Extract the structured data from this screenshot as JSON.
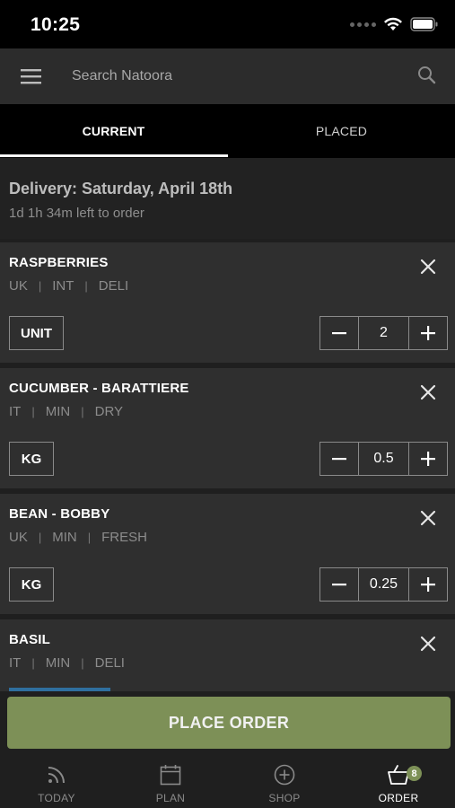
{
  "status_bar": {
    "time": "10:25"
  },
  "search": {
    "placeholder": "Search Natoora"
  },
  "tabs": [
    {
      "label": "CURRENT",
      "active": true
    },
    {
      "label": "PLACED",
      "active": false
    }
  ],
  "delivery": {
    "title": "Delivery: Saturday, April 18th",
    "time_left": "1d 1h 34m left to order"
  },
  "items": [
    {
      "name": "RASPBERRIES",
      "tags": [
        "UK",
        "INT",
        "DELI"
      ],
      "unit": "UNIT",
      "quantity": "2"
    },
    {
      "name": "CUCUMBER - BARATTIERE",
      "tags": [
        "IT",
        "MIN",
        "DRY"
      ],
      "unit": "KG",
      "quantity": "0.5"
    },
    {
      "name": "BEAN - BOBBY",
      "tags": [
        "UK",
        "MIN",
        "FRESH"
      ],
      "unit": "KG",
      "quantity": "0.25"
    },
    {
      "name": "BASIL",
      "tags": [
        "IT",
        "MIN",
        "DELI"
      ]
    }
  ],
  "place_order": {
    "label": "PLACE ORDER",
    "color": "#7d9057"
  },
  "bottom_nav": {
    "items": [
      {
        "label": "TODAY",
        "icon": "feed-icon"
      },
      {
        "label": "PLAN",
        "icon": "calendar-icon"
      },
      {
        "label": "SHOP",
        "icon": "plus-circle-icon"
      },
      {
        "label": "ORDER",
        "icon": "basket-icon",
        "active": true
      }
    ],
    "order_badge": "8"
  }
}
